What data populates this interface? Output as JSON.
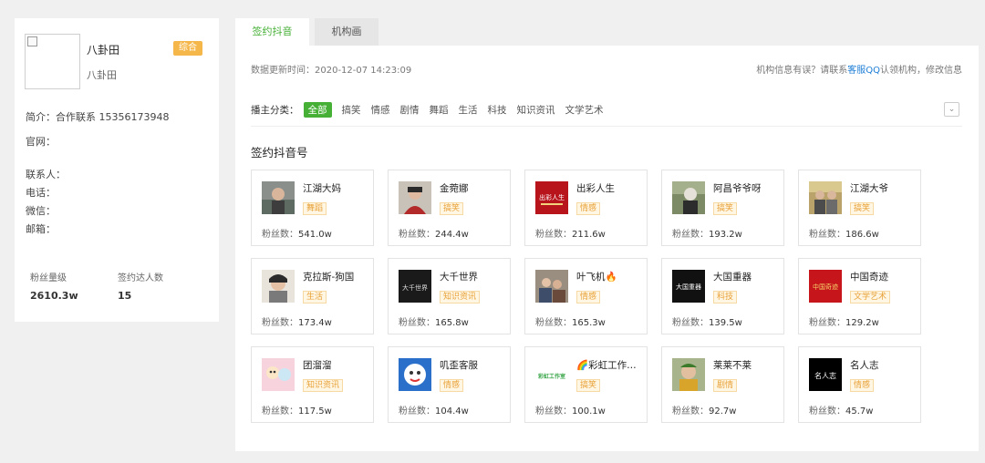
{
  "org": {
    "name": "八卦田",
    "sub_name": "八卦田",
    "type_badge": "综合",
    "intro": "简介：合作联系 15356173948",
    "website": "官网：",
    "contact_person": "联系人：",
    "phone": "电话：",
    "wechat": "微信：",
    "email": "邮箱：",
    "fans_label": "粉丝量级",
    "fans_value": "2610.3w",
    "signed_label": "签约达人数",
    "signed_value": "15"
  },
  "tabs": [
    {
      "label": "签约抖音号",
      "active": true
    },
    {
      "label": "机构画像",
      "active": false
    }
  ],
  "main": {
    "update_time": "数据更新时间：2020-12-07 14:23:09",
    "feedback_prefix": "机构信息有误？请联系",
    "feedback_link": "客服QQ",
    "feedback_suffix": "认领机构，修改信息",
    "filter_label": "播主分类：",
    "filters": [
      "全部",
      "搞笑",
      "情感",
      "剧情",
      "舞蹈",
      "生活",
      "科技",
      "知识资讯",
      "文学艺术"
    ],
    "section_title": "签约抖音号",
    "fans_prefix": "粉丝数："
  },
  "accounts": [
    {
      "name": "江湖大妈",
      "tag": "舞蹈",
      "fans": "541.0w"
    },
    {
      "name": "金菀娜",
      "tag": "搞笑",
      "fans": "244.4w"
    },
    {
      "name": "出彩人生",
      "tag": "情感",
      "fans": "211.6w"
    },
    {
      "name": "阿昌爷爷呀",
      "tag": "搞笑",
      "fans": "193.2w"
    },
    {
      "name": "江湖大爷",
      "tag": "搞笑",
      "fans": "186.6w"
    },
    {
      "name": "克拉斯-狗国",
      "tag": "生活",
      "fans": "173.4w"
    },
    {
      "name": "大千世界",
      "tag": "知识资讯",
      "fans": "165.8w"
    },
    {
      "name": "叶飞机🔥",
      "tag": "情感",
      "fans": "165.3w"
    },
    {
      "name": "大国重器",
      "tag": "科技",
      "fans": "139.5w"
    },
    {
      "name": "中国奇迹",
      "tag": "文学艺术",
      "fans": "129.2w"
    },
    {
      "name": "团溜溜",
      "tag": "知识资讯",
      "fans": "117.5w"
    },
    {
      "name": "叽歪客服",
      "tag": "情感",
      "fans": "104.4w"
    },
    {
      "name": "🌈彩虹工作室...",
      "tag": "搞笑",
      "fans": "100.1w"
    },
    {
      "name": "莱莱不莱",
      "tag": "剧情",
      "fans": "92.7w"
    },
    {
      "name": "名人志",
      "tag": "情感",
      "fans": "45.7w"
    }
  ],
  "thumb_texts": {
    "chucai": "出彩人生",
    "daqian": "大千世界",
    "daguo": "大国重器",
    "zhongguo": "中国奇迹",
    "caihong": "彩虹工作室",
    "mingren": "名人志"
  },
  "colors": {
    "accent_green": "#45b035",
    "badge_orange": "#f6b74a",
    "link_blue": "#1e7fd6",
    "tag_text": "#e8a137"
  }
}
